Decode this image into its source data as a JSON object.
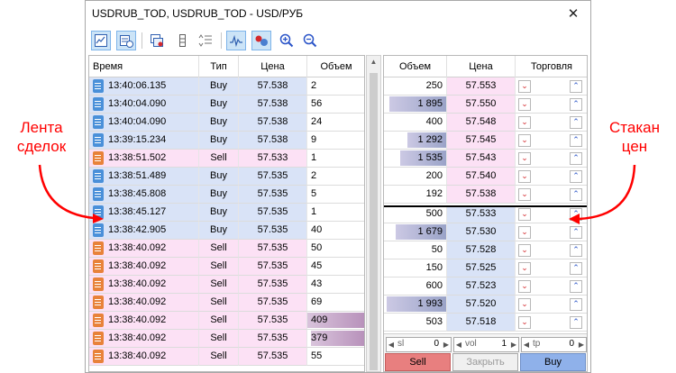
{
  "window": {
    "title": "USDRUB_TOD, USDRUB_TOD - USD/РУБ",
    "close_glyph": "✕"
  },
  "annotations": {
    "left": [
      "Лента",
      "сделок"
    ],
    "right": [
      "Стакан",
      "цен"
    ]
  },
  "toolbar": {
    "buttons": [
      {
        "icon": "chart-icon",
        "active": true
      },
      {
        "icon": "ticks-clock-icon",
        "active": true
      },
      {
        "icon": "charts-stack-icon",
        "active": false
      },
      {
        "icon": "column-icon",
        "active": false
      },
      {
        "icon": "sort-list-icon",
        "active": false
      },
      {
        "icon": "level2-chart-icon",
        "active": true
      },
      {
        "icon": "bubbles-icon",
        "active": true
      },
      {
        "icon": "zoom-in-icon",
        "active": false
      },
      {
        "icon": "zoom-out-icon",
        "active": false
      }
    ]
  },
  "trades": {
    "headers": {
      "time": "Время",
      "type": "Тип",
      "price": "Цена",
      "volume": "Объем"
    },
    "max_volume": 409,
    "rows": [
      {
        "time": "13:40:06.135",
        "type": "Buy",
        "price": "57.538",
        "volume": "2"
      },
      {
        "time": "13:40:04.090",
        "type": "Buy",
        "price": "57.538",
        "volume": "56"
      },
      {
        "time": "13:40:04.090",
        "type": "Buy",
        "price": "57.538",
        "volume": "24"
      },
      {
        "time": "13:39:15.234",
        "type": "Buy",
        "price": "57.538",
        "volume": "9"
      },
      {
        "time": "13:38:51.502",
        "type": "Sell",
        "price": "57.533",
        "volume": "1"
      },
      {
        "time": "13:38:51.489",
        "type": "Buy",
        "price": "57.535",
        "volume": "2"
      },
      {
        "time": "13:38:45.808",
        "type": "Buy",
        "price": "57.535",
        "volume": "5"
      },
      {
        "time": "13:38:45.127",
        "type": "Buy",
        "price": "57.535",
        "volume": "1"
      },
      {
        "time": "13:38:42.905",
        "type": "Buy",
        "price": "57.535",
        "volume": "40"
      },
      {
        "time": "13:38:40.092",
        "type": "Sell",
        "price": "57.535",
        "volume": "50"
      },
      {
        "time": "13:38:40.092",
        "type": "Sell",
        "price": "57.535",
        "volume": "45"
      },
      {
        "time": "13:38:40.092",
        "type": "Sell",
        "price": "57.535",
        "volume": "43"
      },
      {
        "time": "13:38:40.092",
        "type": "Sell",
        "price": "57.535",
        "volume": "69"
      },
      {
        "time": "13:38:40.092",
        "type": "Sell",
        "price": "57.535",
        "volume": "409"
      },
      {
        "time": "13:38:40.092",
        "type": "Sell",
        "price": "57.535",
        "volume": "379"
      },
      {
        "time": "13:38:40.092",
        "type": "Sell",
        "price": "57.535",
        "volume": "55"
      }
    ]
  },
  "depth": {
    "headers": {
      "volume": "Объем",
      "price": "Цена",
      "trade": "Торговля"
    },
    "max_volume": 1993,
    "asks": [
      {
        "volume": "250",
        "value": 250,
        "price": "57.553"
      },
      {
        "volume": "1 895",
        "value": 1895,
        "price": "57.550"
      },
      {
        "volume": "400",
        "value": 400,
        "price": "57.548"
      },
      {
        "volume": "1 292",
        "value": 1292,
        "price": "57.545"
      },
      {
        "volume": "1 535",
        "value": 1535,
        "price": "57.543"
      },
      {
        "volume": "200",
        "value": 200,
        "price": "57.540"
      },
      {
        "volume": "192",
        "value": 192,
        "price": "57.538"
      }
    ],
    "bids": [
      {
        "volume": "500",
        "value": 500,
        "price": "57.533"
      },
      {
        "volume": "1 679",
        "value": 1679,
        "price": "57.530"
      },
      {
        "volume": "50",
        "value": 50,
        "price": "57.528"
      },
      {
        "volume": "150",
        "value": 150,
        "price": "57.525"
      },
      {
        "volume": "600",
        "value": 600,
        "price": "57.523"
      },
      {
        "volume": "1 993",
        "value": 1993,
        "price": "57.520"
      },
      {
        "volume": "503",
        "value": 503,
        "price": "57.518"
      }
    ],
    "sell_mark": "⌄",
    "buy_mark": "⌃"
  },
  "order": {
    "sl": {
      "label": "sl",
      "value": "0"
    },
    "vol": {
      "label": "vol",
      "value": "1"
    },
    "tp": {
      "label": "tp",
      "value": "0"
    },
    "sell_label": "Sell",
    "close_label": "Закрыть",
    "buy_label": "Buy"
  },
  "colors": {
    "buy_bg": "#d9e3f7",
    "sell_bg": "#fce1f5",
    "buy_icon": "#4a90d9",
    "sell_icon": "#e8823a",
    "annotation": "#ff0000",
    "sell_button": "#e87f7f",
    "buy_button": "#8fb1ea"
  }
}
